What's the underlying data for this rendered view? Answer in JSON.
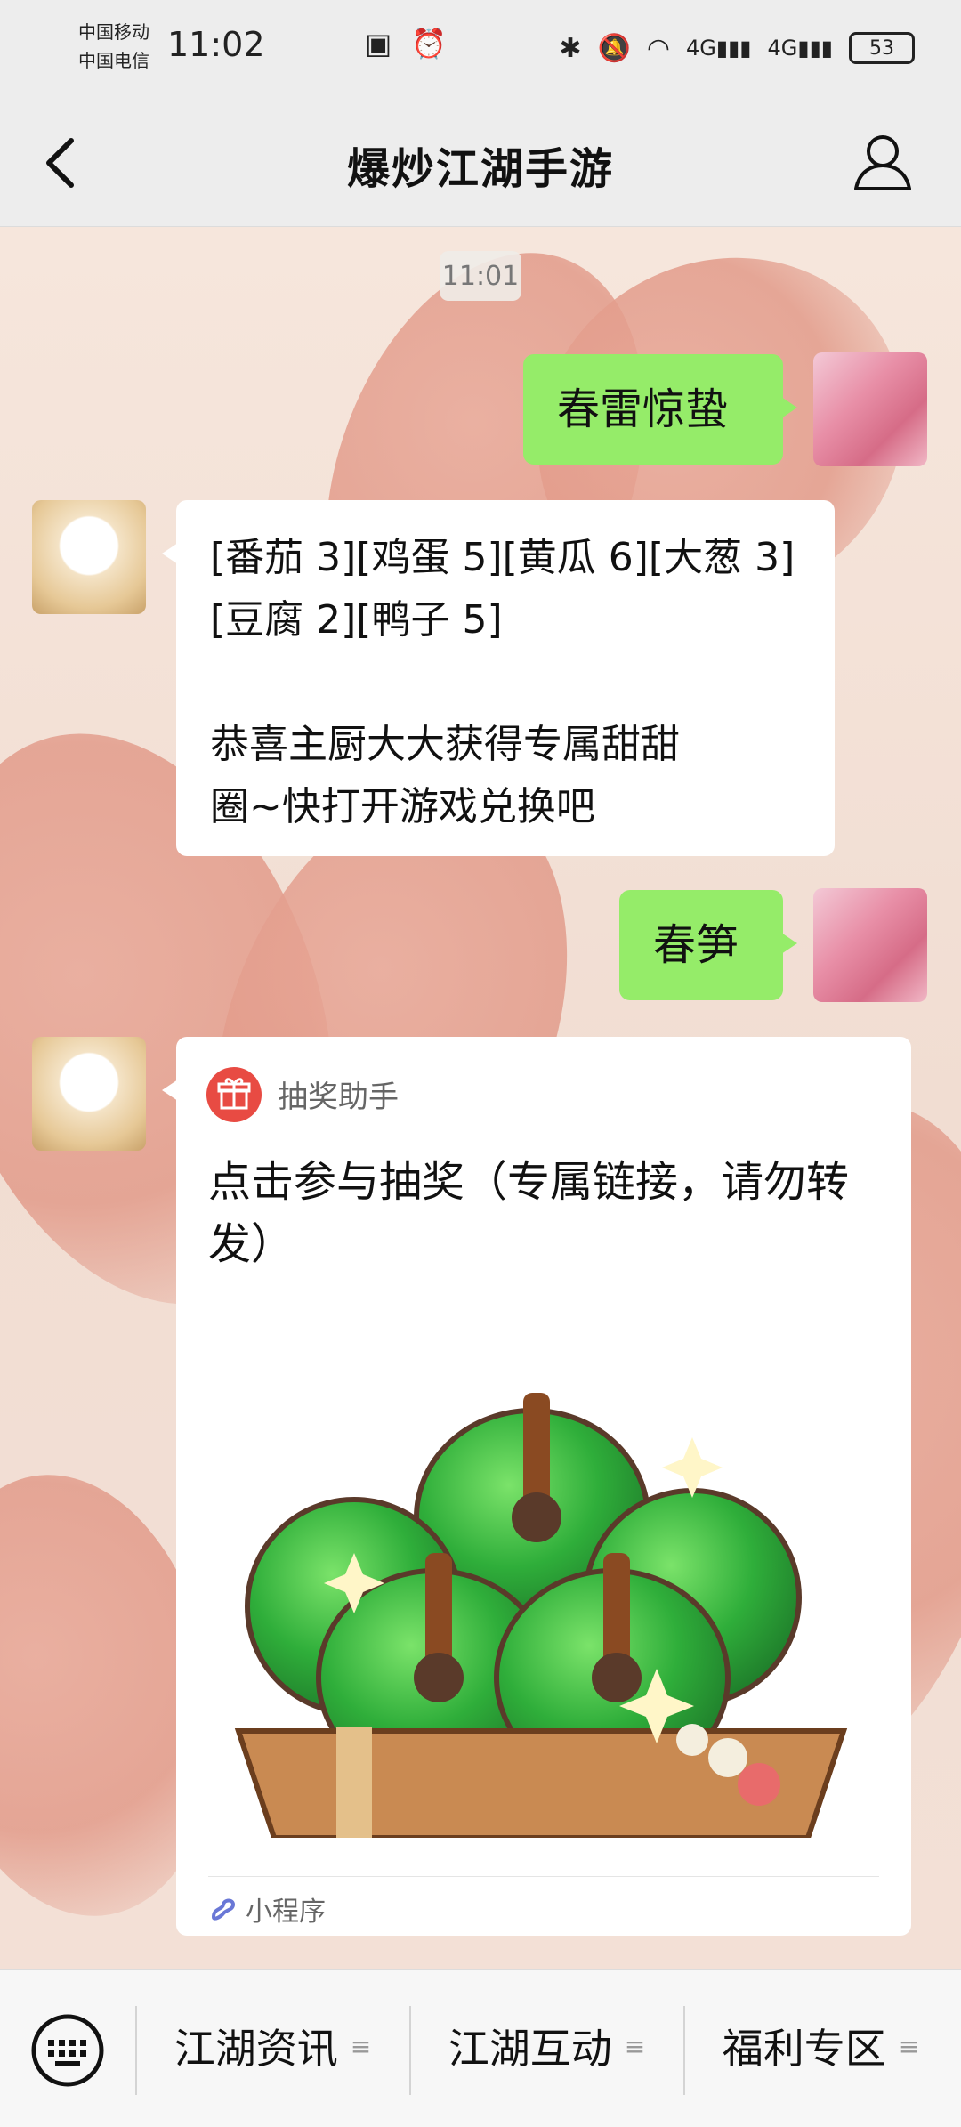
{
  "status_bar": {
    "carrier_1": "中国移动",
    "carrier_2": "中国电信",
    "time": "11:02",
    "battery": "53"
  },
  "header": {
    "title": "爆炒江湖手游",
    "back_icon": "chevron-left-icon",
    "profile_icon": "person-icon"
  },
  "chat": {
    "timestamp": "11:01",
    "messages": [
      {
        "from": "me",
        "text": "春雷惊蛰"
      },
      {
        "from": "bot",
        "text": "[番茄 3][鸡蛋 5][黄瓜 6][大葱 3]\n[豆腐 2][鸭子 5]\n\n恭喜主厨大大获得专属甜甜\n圈~快打开游戏兑换吧"
      },
      {
        "from": "me",
        "text": "春笋"
      }
    ],
    "card": {
      "app_name": "抽奖助手",
      "title": "点击参与抽奖（专属链接，请勿转发）",
      "footer": "小程序"
    }
  },
  "bottom_menu": {
    "keyboard_icon": "keyboard-icon",
    "items": [
      "江湖资讯",
      "江湖互动",
      "福利专区"
    ]
  },
  "colors": {
    "accent_green": "#95ec69",
    "gift_red": "#e84b43",
    "bar_gray": "#ededed"
  }
}
